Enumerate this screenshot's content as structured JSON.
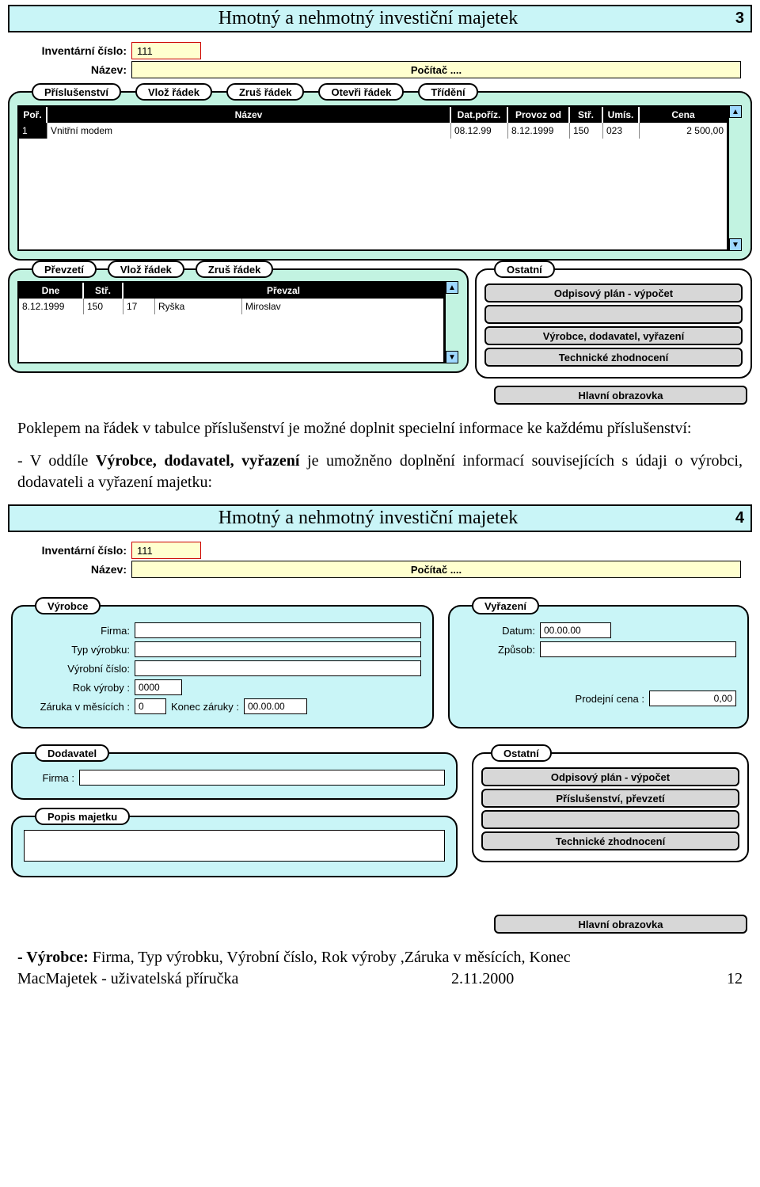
{
  "screenshot1": {
    "title": "Hmotný a nehmotný investiční majetek",
    "page": "3",
    "inv_label": "Inventární číslo:",
    "inv_value": "111",
    "nazev_label": "Název:",
    "nazev_value": "Počítač ....",
    "accessories": {
      "tab": "Příslušenství",
      "buttons": [
        "Vlož řádek",
        "Zruš řádek",
        "Otevři řádek",
        "Třídění"
      ],
      "cols": {
        "por": "Poř.",
        "nazev": "Název",
        "dat": "Dat.poříz.",
        "provoz": "Provoz od",
        "str": "Stř.",
        "umis": "Umís.",
        "cena": "Cena"
      },
      "row": {
        "por": "1",
        "nazev": "Vnitřní modem",
        "dat": "08.12.99",
        "provoz": "8.12.1999",
        "str": "150",
        "umis": "023",
        "cena": "2 500,00"
      }
    },
    "takeover": {
      "tab": "Převzetí",
      "buttons": [
        "Vlož řádek",
        "Zruš řádek"
      ],
      "cols": {
        "dne": "Dne",
        "str": "Stř.",
        "prevzal": "Převzal"
      },
      "row": {
        "dne": "8.12.1999",
        "str": "150",
        "prevzal1": "17",
        "prevzal2": "Ryška",
        "prevzal3": "Miroslav"
      }
    },
    "ostatni": {
      "tab": "Ostatní",
      "btn1": "Odpisový plán - výpočet",
      "btn2": "",
      "btn3": "Výrobce, dodavatel, vyřazení",
      "btn4": "Technické zhodnocení"
    },
    "main_btn": "Hlavní obrazovka"
  },
  "text1": "Poklepem na řádek v tabulce příslušenství je možné doplnit specielní informace ke každému příslušenství:",
  "text2_a": "- V oddíle ",
  "text2_b": "Výrobce, dodavatel, vyřazení",
  "text2_c": " je umožněno doplnění informací souvisejících s údaji o výrobci, dodavateli a vyřazení majetku:",
  "screenshot2": {
    "title": "Hmotný a nehmotný investiční majetek",
    "page": "4",
    "inv_label": "Inventární číslo:",
    "inv_value": "111",
    "nazev_label": "Název:",
    "nazev_value": "Počítač ....",
    "vyrobce": {
      "tab": "Výrobce",
      "firma_l": "Firma:",
      "firma_v": "",
      "typ_l": "Typ výrobku:",
      "typ_v": "",
      "vyrcislo_l": "Výrobní číslo:",
      "vyrcislo_v": "",
      "rok_l": "Rok výroby :",
      "rok_v": "0000",
      "zaruka_l": "Záruka v měsících :",
      "zaruka_v": "0",
      "konec_l": "Konec záruky :",
      "konec_v": "00.00.00"
    },
    "vyrazeni": {
      "tab": "Vyřazení",
      "datum_l": "Datum:",
      "datum_v": "00.00.00",
      "zpusob_l": "Způsob:",
      "zpusob_v": "",
      "cena_l": "Prodejní cena :",
      "cena_v": "0,00"
    },
    "dodavatel": {
      "tab": "Dodavatel",
      "firma_l": "Firma :",
      "firma_v": ""
    },
    "popis": {
      "tab": "Popis majetku",
      "value": ""
    },
    "ostatni": {
      "tab": "Ostatní",
      "btn1": "Odpisový plán - výpočet",
      "btn2": "Příslušenství, převzetí",
      "btn3": "",
      "btn4": "Technické zhodnocení"
    },
    "main_btn": "Hlavní obrazovka"
  },
  "text3_a": "- Výrobce:",
  "text3_b": "  Firma, Typ výrobku, Výrobní číslo, Rok výroby ,Záruka v měsících, Konec",
  "footer": {
    "left": "MacMajetek - uživatelská příručka",
    "mid": "2.11.2000",
    "right": "12"
  }
}
